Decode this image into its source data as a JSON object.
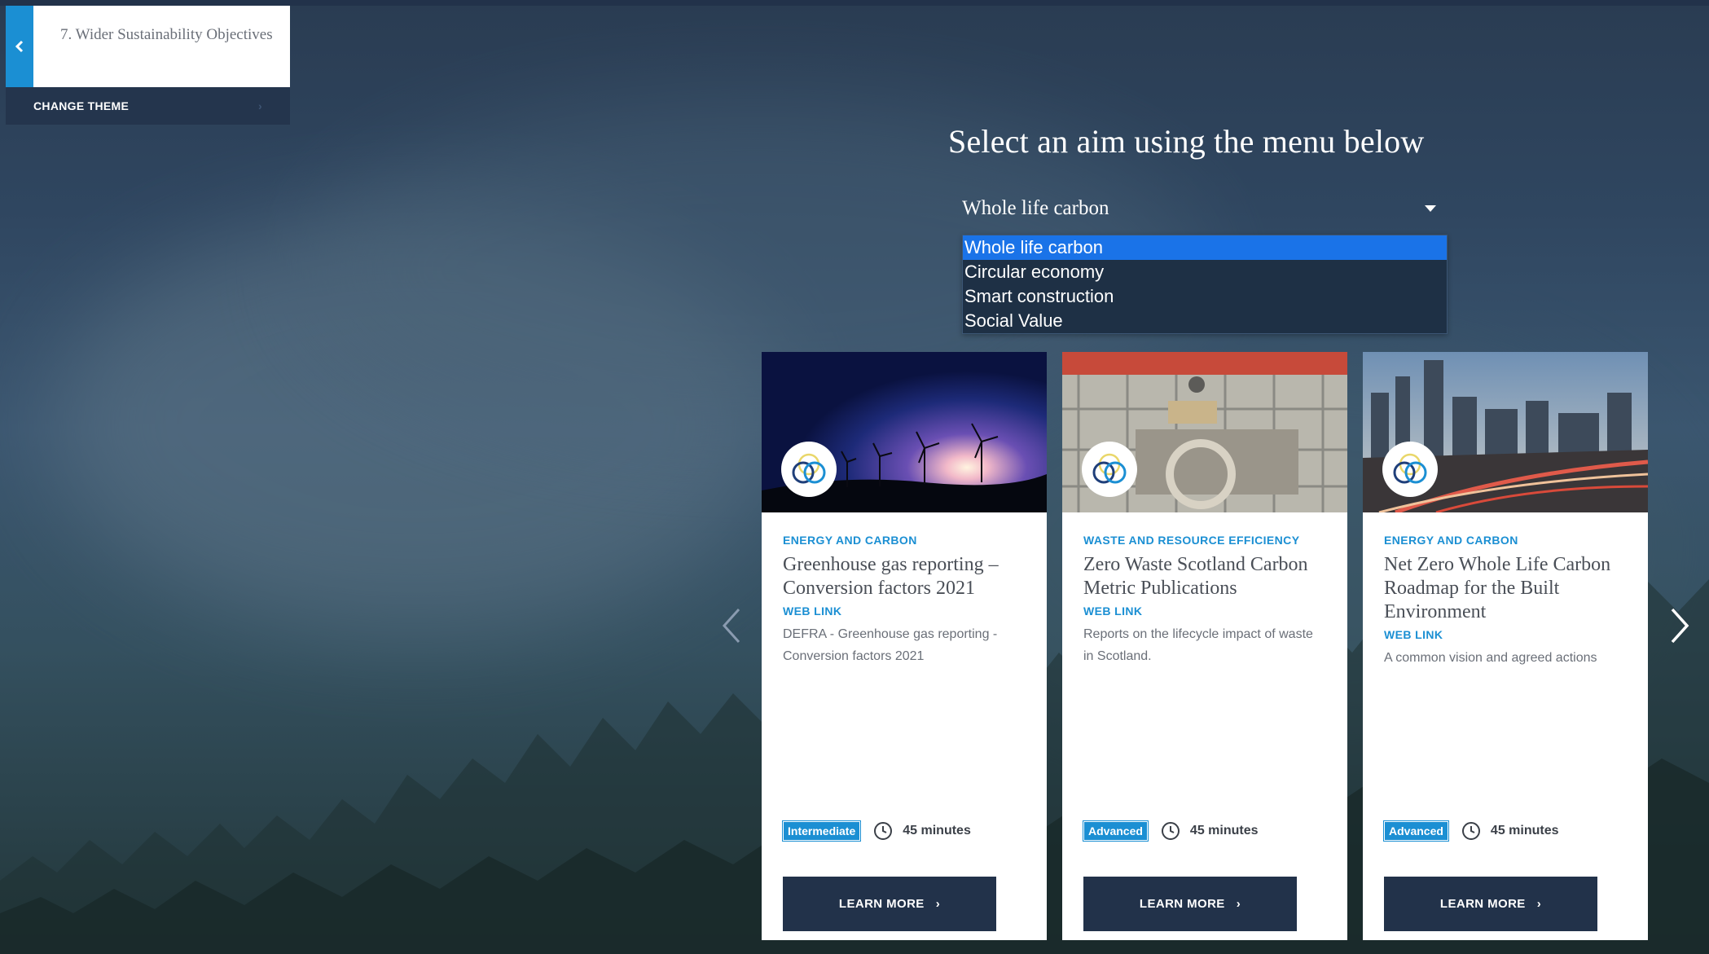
{
  "theme_panel": {
    "title": "7. Wider Sustainability Objectives",
    "change_theme_label": "CHANGE THEME"
  },
  "aim_selector": {
    "heading": "Select an aim using the menu below",
    "selected": "Whole life carbon",
    "options": [
      "Whole life carbon",
      "Circular economy",
      "Smart construction",
      "Social Value"
    ]
  },
  "cards": [
    {
      "category": "ENERGY AND CARBON",
      "title": "Greenhouse gas reporting – Conversion factors 2021",
      "link_type": "WEB LINK",
      "description": "DEFRA - Greenhouse gas reporting - Conversion factors 2021",
      "level": "Intermediate",
      "duration": "45 minutes",
      "button": "LEARN MORE"
    },
    {
      "category": "WASTE AND RESOURCE EFFICIENCY",
      "title": "Zero Waste Scotland Carbon Metric Publications",
      "link_type": "WEB LINK",
      "description": "Reports on the lifecycle impact of waste in Scotland.",
      "level": "Advanced",
      "duration": "45 minutes",
      "button": "LEARN MORE"
    },
    {
      "category": "ENERGY AND CARBON",
      "title": "Net Zero Whole Life Carbon Roadmap for the Built Environment",
      "link_type": "WEB LINK",
      "description": "A common vision and agreed actions",
      "level": "Advanced",
      "duration": "45 minutes",
      "button": "LEARN MORE"
    }
  ],
  "colors": {
    "accent": "#1b8fd3",
    "navy": "#22324a",
    "selected_option": "#1a73e8"
  },
  "icons": {
    "back": "chevron-left-icon",
    "select": "caret-down-icon",
    "prev": "chevron-left-icon",
    "next": "chevron-right-icon",
    "duration": "clock-icon",
    "badge": "interlocking-rings-icon"
  }
}
